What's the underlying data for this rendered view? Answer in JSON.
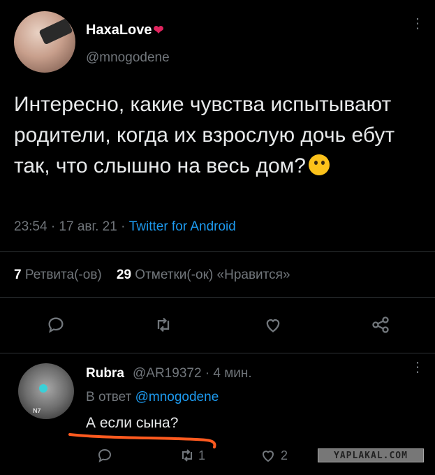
{
  "tweet": {
    "display_name": "HaxaLove",
    "heart": "❤",
    "handle": "@mnogodene",
    "text": "Интересно, какие чувства испытывают родители, когда их взрослую дочь ебут так, что слышно на весь дом?",
    "emoji_name": "thinking-face",
    "time": "23:54 · 17 авг. 21 · ",
    "source": "Twitter for Android",
    "more": "⋮"
  },
  "stats": {
    "retweets_count": "7",
    "retweets_label": "Ретвита(-ов)",
    "likes_count": "29",
    "likes_label": "Отметки(-ок) «Нравится»"
  },
  "actions": [
    "reply-icon",
    "retweet-icon",
    "like-icon",
    "share-icon"
  ],
  "reply": {
    "display_name": "Rubra",
    "handle_time": "@AR19372 · 4 мин.",
    "in_reply_prefix": "В ответ ",
    "in_reply_handle": "@mnogodene",
    "text": "А если сына?",
    "retweets": "1",
    "likes": "2",
    "avatar_badge": "N7",
    "more": "⋮"
  },
  "watermark": "YAPLAKAL.COM",
  "colors": {
    "background": "#000000",
    "text": "#e7e9ea",
    "muted": "#71767b",
    "link": "#1d9bf0",
    "heart": "#e0245e",
    "annotation": "#ff5a1f"
  }
}
